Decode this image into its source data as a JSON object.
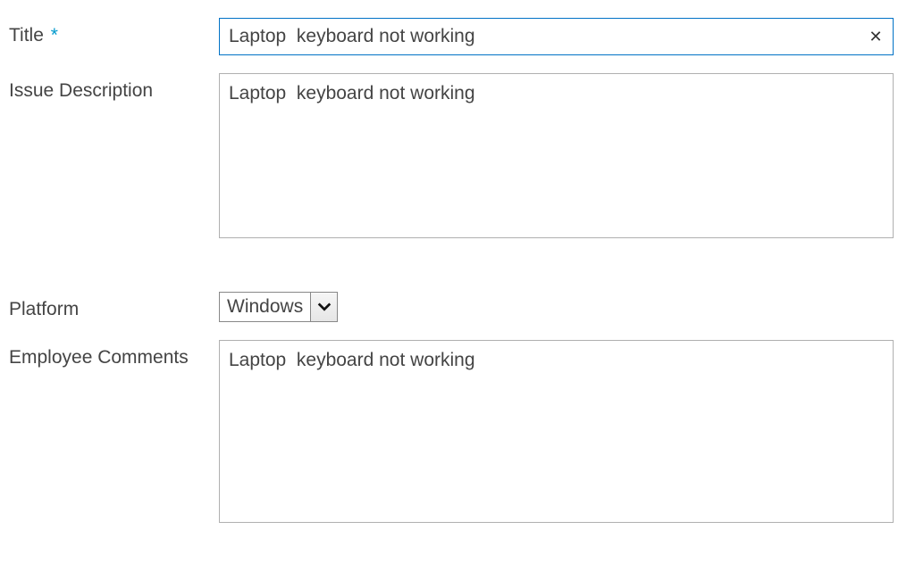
{
  "fields": {
    "title": {
      "label": "Title",
      "required_marker": "*",
      "value": "Laptop  keyboard not working",
      "clear_glyph": "✕"
    },
    "issue_description": {
      "label": "Issue Description",
      "value": "Laptop  keyboard not working"
    },
    "platform": {
      "label": "Platform",
      "selected": "Windows"
    },
    "employee_comments": {
      "label": "Employee Comments",
      "value": "Laptop  keyboard not working"
    }
  }
}
